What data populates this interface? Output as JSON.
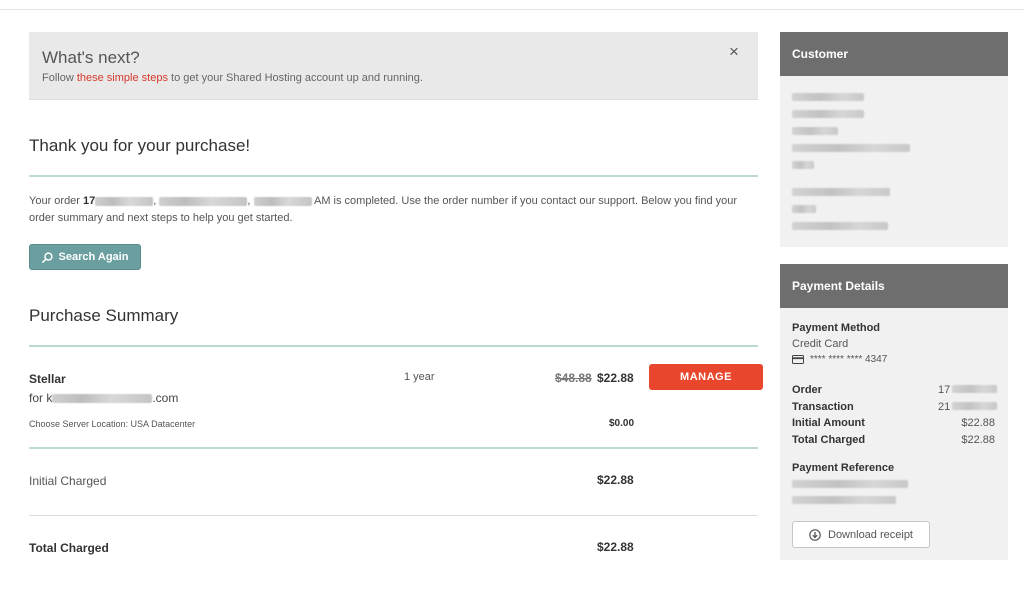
{
  "notice": {
    "title": "What's next?",
    "text_before": "Follow ",
    "link": "these simple steps",
    "text_after": " to get your Shared Hosting account up and running.",
    "close": "×"
  },
  "confirmation": {
    "title": "Thank you for your purchase!",
    "order_prefix": "Your order ",
    "order_number_visible": "17",
    "time_suffix": "AM is completed. Use the order number if you contact our support. Below you find your order summary and next steps to help you get started.",
    "search_again": "Search Again"
  },
  "summary": {
    "title": "Purchase Summary",
    "item": {
      "name": "Stellar",
      "domain_prefix": "for k",
      "domain_suffix": ".com",
      "term": "1 year",
      "original_price": "$48.88",
      "price": "$22.88",
      "manage": "MANAGE"
    },
    "server_location": "Choose Server Location: USA Datacenter",
    "server_price": "$0.00",
    "initial_charged_label": "Initial Charged",
    "initial_charged_value": "$22.88",
    "total_charged_label": "Total Charged",
    "total_charged_value": "$22.88"
  },
  "customer": {
    "title": "Customer"
  },
  "payment": {
    "title": "Payment Details",
    "method_label": "Payment Method",
    "method_value": "Credit Card",
    "card_masked": "**** **** **** 4347",
    "order_label": "Order",
    "order_prefix": "17",
    "transaction_label": "Transaction",
    "transaction_prefix": "21",
    "initial_amount_label": "Initial Amount",
    "initial_amount_value": "$22.88",
    "total_charged_label": "Total Charged",
    "total_charged_value": "$22.88",
    "reference_label": "Payment Reference",
    "download_receipt": "Download receipt"
  },
  "colors": {
    "accent_red": "#e8472d",
    "link_red": "#d6392b",
    "teal_button": "#6a9e9f",
    "panel_header": "#6e6e6e",
    "teal_rule": "#bcd9d2"
  },
  "icons": {
    "close": "close-icon",
    "search": "search-icon",
    "card": "credit-card-icon",
    "download": "download-icon"
  }
}
